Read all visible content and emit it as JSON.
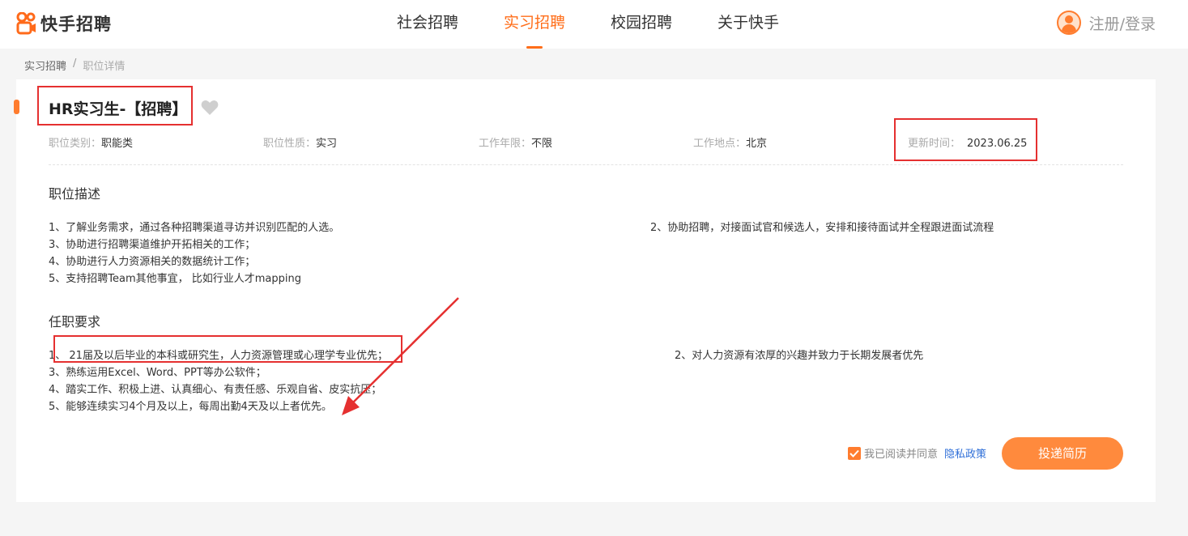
{
  "header": {
    "logo_text": "快手招聘",
    "nav": [
      "社会招聘",
      "实习招聘",
      "校园招聘",
      "关于快手"
    ],
    "active_index": 1,
    "login": "注册/登录",
    "accent_color": "#ff6e1a"
  },
  "breadcrumb": [
    "实习招聘",
    "/",
    "职位详情"
  ],
  "job": {
    "title": "HR实习生-【招聘】",
    "meta": [
      {
        "key": "职位类别：",
        "value": "职能类"
      },
      {
        "key": "职位性质：",
        "value": "实习"
      },
      {
        "key": "工作年限：",
        "value": "不限"
      },
      {
        "key": "工作地点：",
        "value": "北京"
      },
      {
        "key": "更新时间：",
        "value": "2023.06.25"
      }
    ]
  },
  "description": {
    "title": "职位描述",
    "lines": [
      "1、了解业务需求，通过各种招聘渠道寻访并识别匹配的人选。",
      "2、协助招聘，对接面试官和候选人，安排和接待面试并全程跟进面试流程",
      "3、协助进行招聘渠道维护开拓相关的工作；",
      "4、协助进行人力资源相关的数据统计工作；",
      "5、支持招聘Team其他事宜， 比如行业人才mapping"
    ]
  },
  "requirements": {
    "title": "任职要求",
    "lines": [
      "1、 21届及以后毕业的本科或研究生，人力资源管理或心理学专业优先；",
      "2、对人力资源有浓厚的兴趣并致力于长期发展者优先",
      "3、熟练运用Excel、Word、PPT等办公软件；",
      "4、踏实工作、积极上进、认真细心、有责任感、乐观自省、皮实抗压；",
      "5、能够连续实习4个月及以上，每周出勤4天及以上者优先。"
    ]
  },
  "footer": {
    "agree_text": "我已阅读并同意",
    "privacy": "隐私政策",
    "apply": "投递简历",
    "agreed": true
  },
  "icons": {
    "favorite": "heart-icon",
    "checkbox": "check-icon",
    "avatar": "user-icon"
  }
}
